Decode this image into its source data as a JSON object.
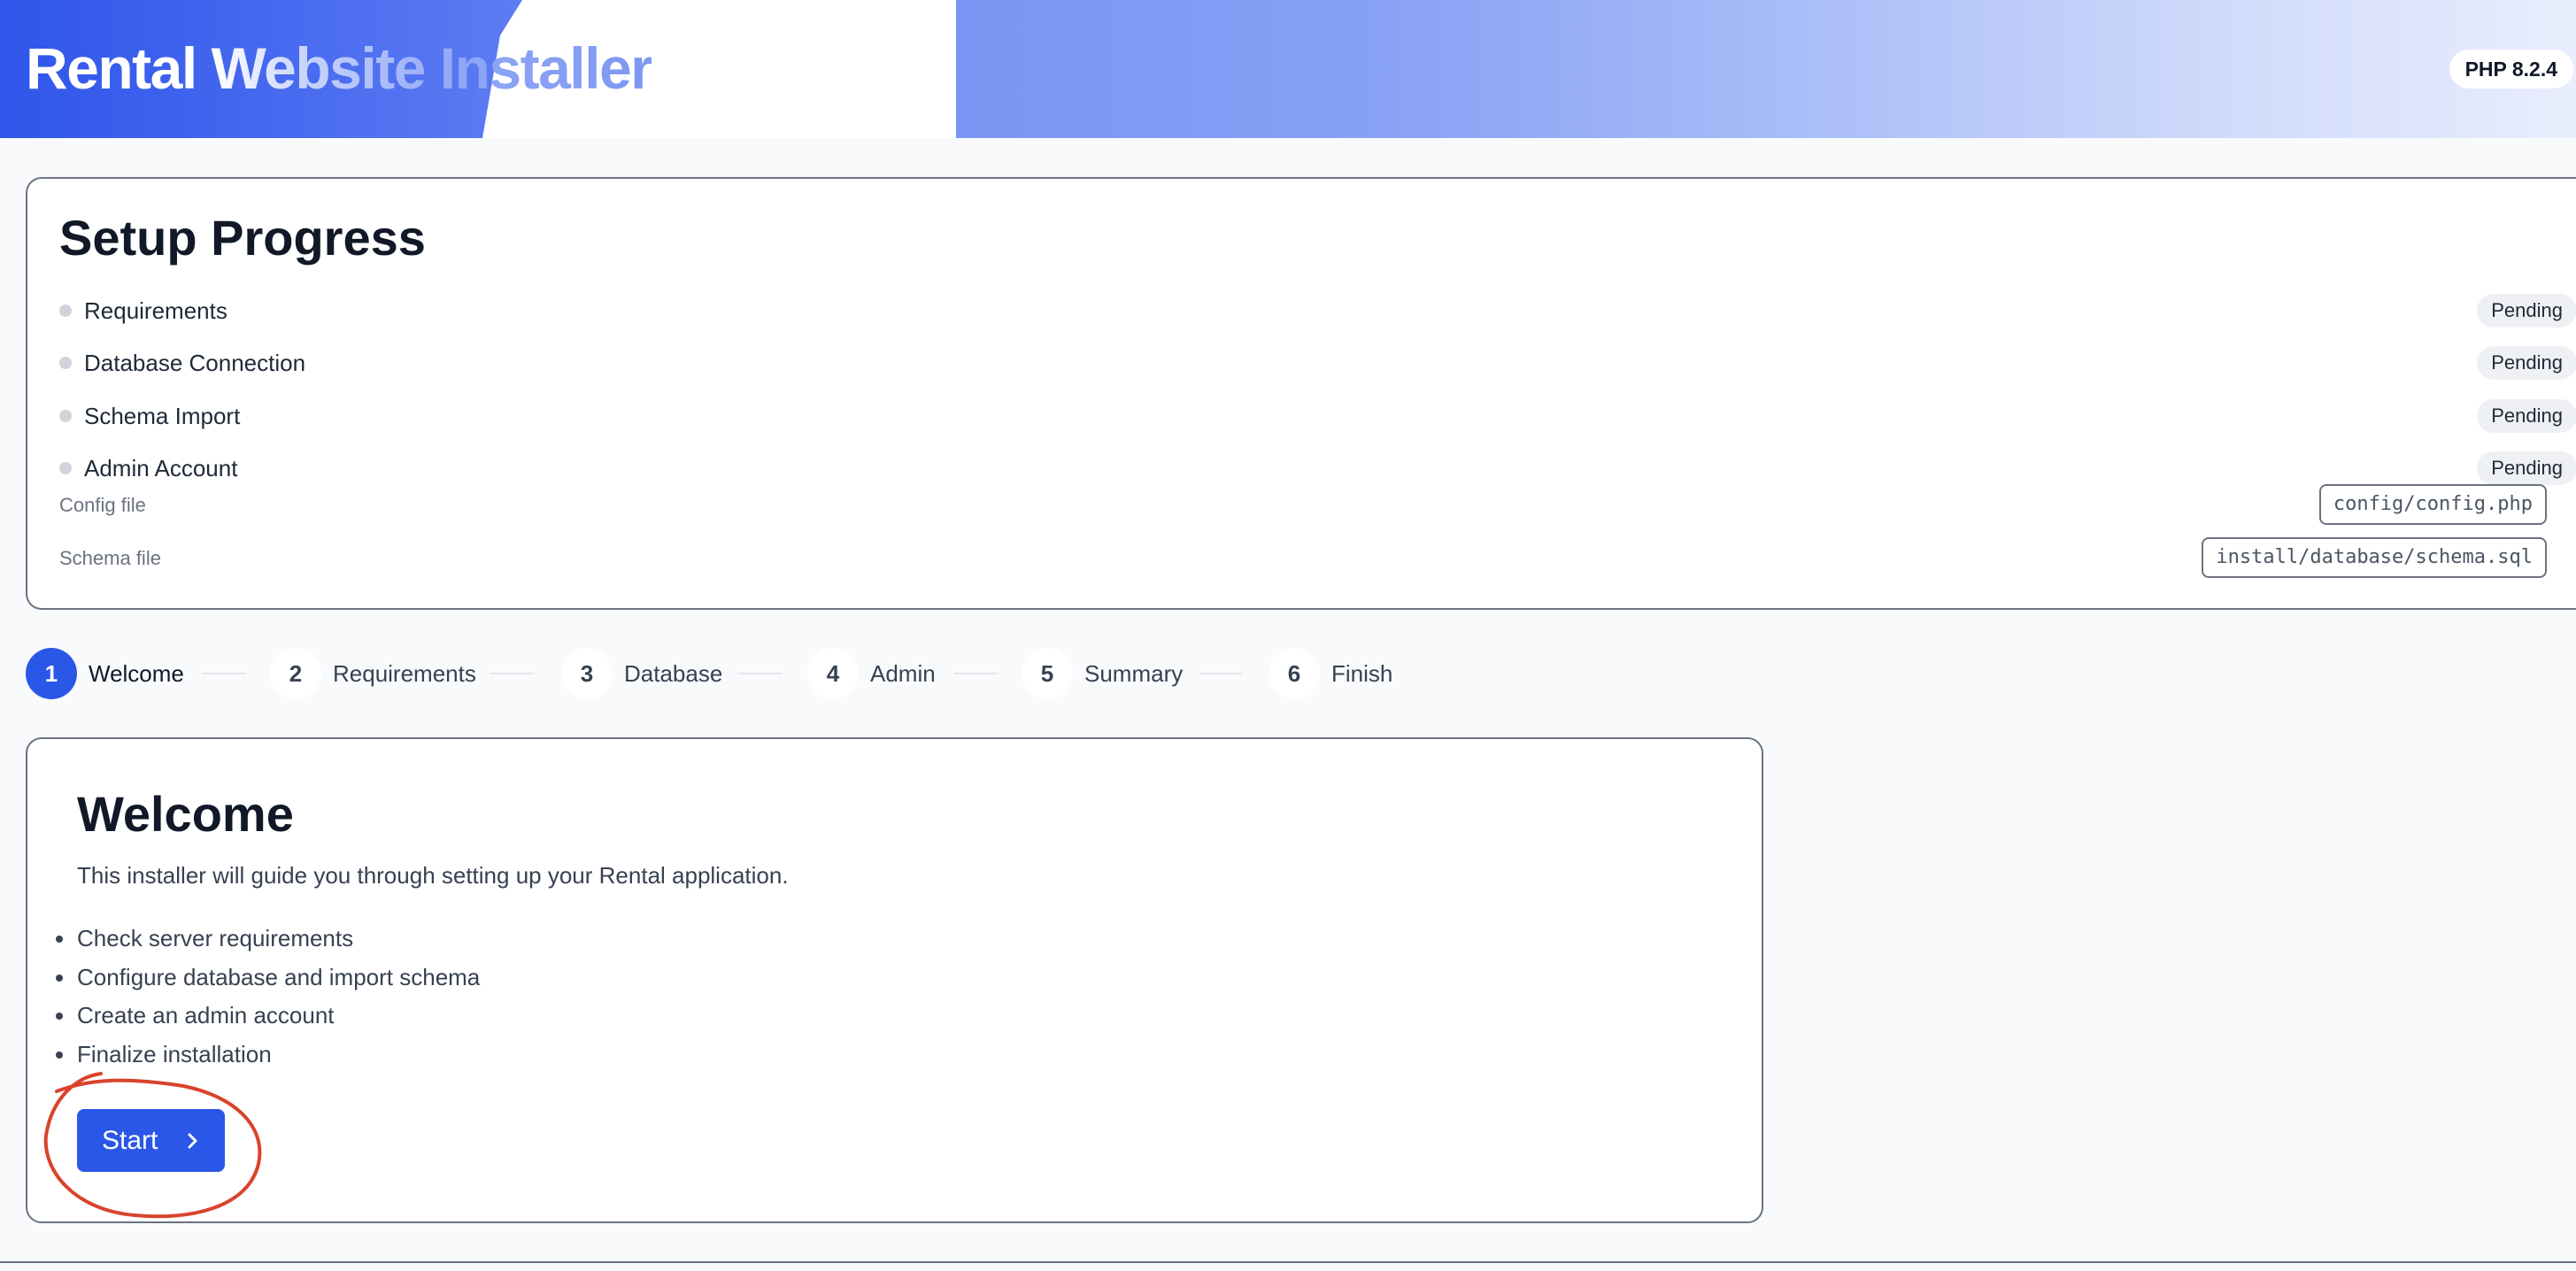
{
  "header": {
    "title": "Rental Website Installer",
    "php_version": "PHP 8.2.4"
  },
  "progress": {
    "title": "Setup Progress",
    "items": [
      {
        "label": "Requirements",
        "status": "Pending"
      },
      {
        "label": "Database Connection",
        "status": "Pending"
      },
      {
        "label": "Schema Import",
        "status": "Pending"
      },
      {
        "label": "Admin Account",
        "status": "Pending"
      }
    ],
    "files": [
      {
        "label": "Config file",
        "path": "config/config.php"
      },
      {
        "label": "Schema file",
        "path": "install/database/schema.sql"
      }
    ]
  },
  "stepper": {
    "steps": [
      {
        "number": "1",
        "label": "Welcome",
        "active": true
      },
      {
        "number": "2",
        "label": "Requirements",
        "active": false
      },
      {
        "number": "3",
        "label": "Database",
        "active": false
      },
      {
        "number": "4",
        "label": "Admin",
        "active": false
      },
      {
        "number": "5",
        "label": "Summary",
        "active": false
      },
      {
        "number": "6",
        "label": "Finish",
        "active": false
      }
    ]
  },
  "welcome": {
    "title": "Welcome",
    "description": "This installer will guide you through setting up your Rental application.",
    "features": [
      "Check server requirements",
      "Configure database and import schema",
      "Create an admin account",
      "Finalize installation"
    ],
    "start_label": "Start",
    "start_icon": "chevron-right-icon"
  },
  "colors": {
    "accent": "#2b57e8",
    "annotation": "#d9432b"
  }
}
